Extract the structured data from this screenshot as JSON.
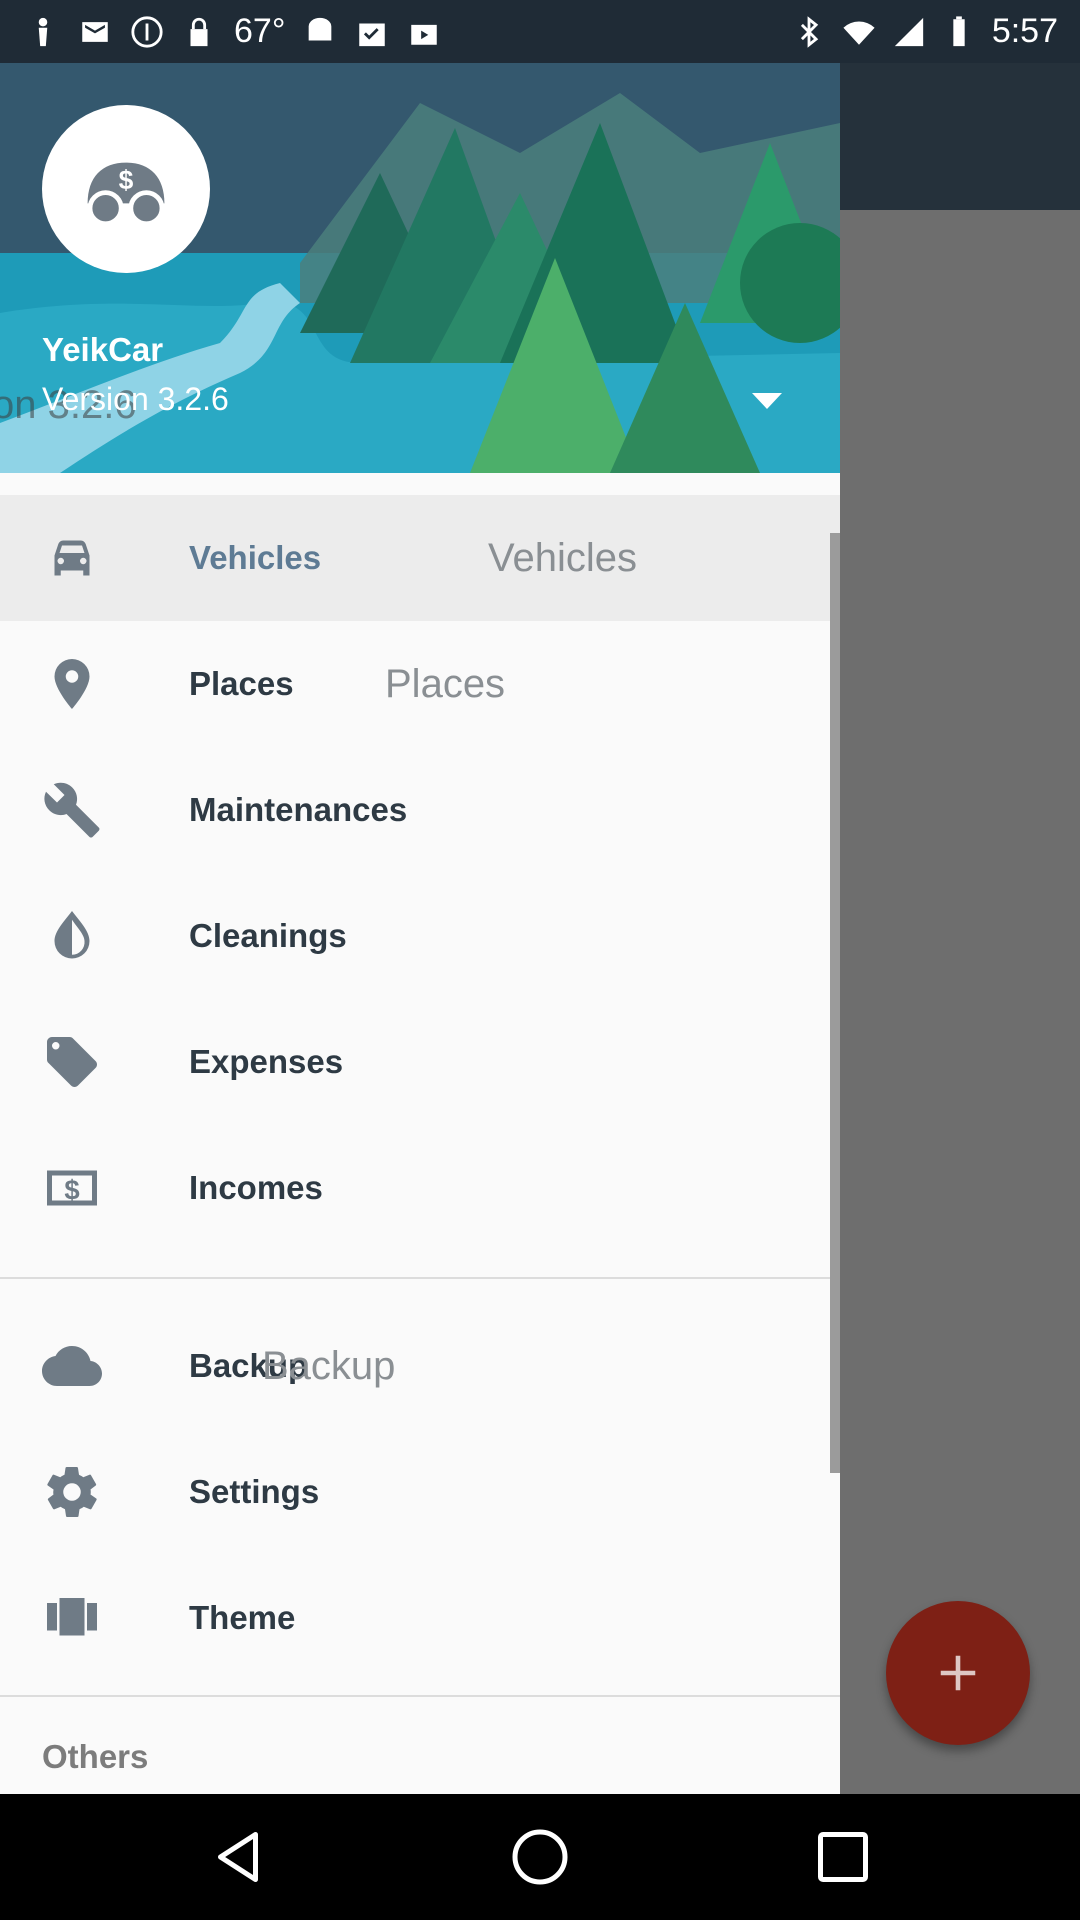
{
  "status_bar": {
    "temperature": "67°",
    "time": "5:57",
    "left_icons": [
      "person-icon",
      "mail-icon",
      "alert-icon",
      "lock-icon",
      "android-icon",
      "clipboard-check-icon",
      "briefcase-play-icon"
    ],
    "right_icons": [
      "bluetooth-icon",
      "wifi-icon",
      "signal-icon",
      "battery-icon"
    ]
  },
  "drawer": {
    "header": {
      "app_name": "YeikCar",
      "version": "Version 3.2.6",
      "version_ghost": "on 3.2.6"
    },
    "items": [
      {
        "label": "Vehicles",
        "icon": "car-icon",
        "ghost": "Vehicles",
        "active": true
      },
      {
        "label": "Places",
        "icon": "map-pin-icon",
        "ghost": "Places"
      },
      {
        "label": "Maintenances",
        "icon": "wrench-icon"
      },
      {
        "label": "Cleanings",
        "icon": "water-drop-icon"
      },
      {
        "label": "Expenses",
        "icon": "tag-icon"
      },
      {
        "label": "Incomes",
        "icon": "dollar-bill-icon"
      }
    ],
    "secondary_items": [
      {
        "label": "Backup",
        "icon": "cloud-icon",
        "ghost": "Backup"
      },
      {
        "label": "Settings",
        "icon": "gear-icon"
      },
      {
        "label": "Theme",
        "icon": "theme-icon"
      }
    ],
    "others_title": "Others"
  },
  "colors": {
    "accent": "#5e7b94",
    "fab": "#7e2015",
    "toolbar": "#25313b"
  }
}
